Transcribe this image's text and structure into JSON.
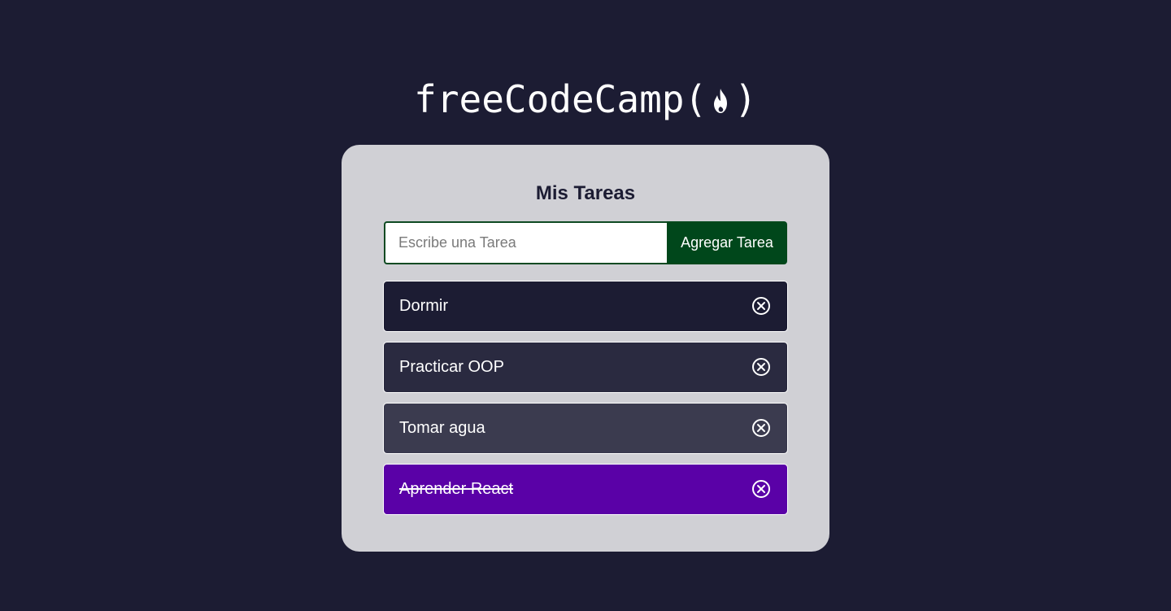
{
  "logo": {
    "text": "freeCodeCamp",
    "open_paren": "(",
    "close_paren": ")",
    "icon": "flame-icon"
  },
  "card": {
    "title": "Mis Tareas",
    "background": "#d0d0d5"
  },
  "form": {
    "input_placeholder": "Escribe una Tarea",
    "input_value": "",
    "button_label": "Agregar Tarea",
    "button_color": "#00471b"
  },
  "tasks": [
    {
      "text": "Dormir",
      "completed": false,
      "color": "#1c1c33",
      "icon": "close-circle-icon"
    },
    {
      "text": "Practicar OOP",
      "completed": false,
      "color": "#2a2a40",
      "icon": "close-circle-icon"
    },
    {
      "text": "Tomar agua",
      "completed": false,
      "color": "#3b3b4f",
      "icon": "close-circle-icon"
    },
    {
      "text": "Aprender React",
      "completed": true,
      "color": "#5a01a7",
      "icon": "close-circle-icon"
    }
  ],
  "colors": {
    "page_background": "#1c1c33",
    "text_light": "#ffffff"
  }
}
